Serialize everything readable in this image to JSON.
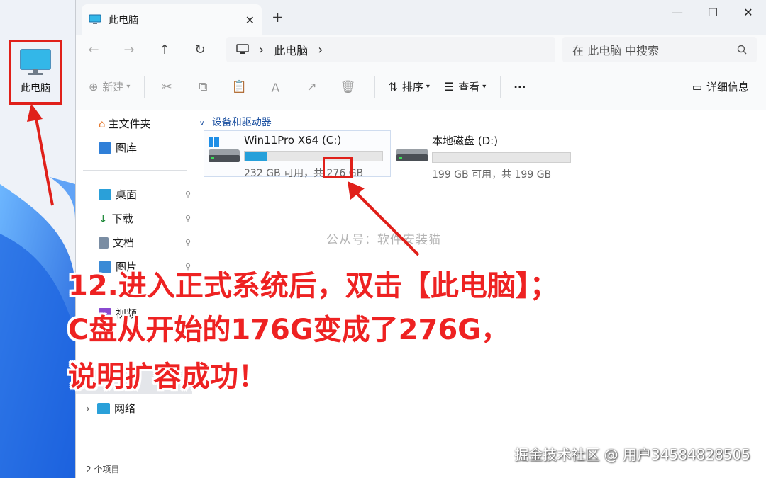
{
  "desktop": {
    "icon_label": "此电脑"
  },
  "window": {
    "tab_title": "此电脑",
    "tab_close": "✕",
    "new_tab": "+",
    "controls": {
      "minimize": "—",
      "maximize": "☐",
      "close": "✕"
    }
  },
  "nav": {
    "back": "←",
    "forward": "→",
    "up": "↑",
    "refresh": "↻",
    "breadcrumb": "此电脑",
    "chevron": "›",
    "search_placeholder": "在 此电脑 中搜索"
  },
  "toolbar": {
    "new_label": "新建",
    "sort_label": "排序",
    "view_label": "查看",
    "more_label": "···",
    "details_label": "详细信息"
  },
  "sidebar": {
    "items": [
      {
        "label": "主文件夹",
        "icon": "home-icon",
        "pinned": false
      },
      {
        "label": "图库",
        "icon": "gallery-icon",
        "pinned": false
      },
      {
        "label": "桌面",
        "icon": "desktop-folder-icon",
        "pinned": true
      },
      {
        "label": "下载",
        "icon": "download-icon",
        "pinned": true
      },
      {
        "label": "文档",
        "icon": "document-icon",
        "pinned": true
      },
      {
        "label": "图片",
        "icon": "picture-icon",
        "pinned": true
      },
      {
        "label": "视频",
        "icon": "video-icon",
        "pinned": false
      },
      {
        "label": "网络",
        "icon": "network-icon",
        "pinned": false
      }
    ],
    "pin_glyph": "📌",
    "expand_glyph": "›"
  },
  "content": {
    "group_header": "设备和驱动器",
    "drives": [
      {
        "name": "Win11Pro X64 (C:)",
        "space_text": "232 GB 可用，共 276 GB",
        "used_fraction": 0.16,
        "icon": "windows-drive-icon"
      },
      {
        "name": "本地磁盘 (D:)",
        "space_text": "199 GB 可用，共 199 GB",
        "used_fraction": 0.0,
        "icon": "drive-icon"
      }
    ]
  },
  "status": {
    "item_count": "2 个项目"
  },
  "overlay": {
    "watermark": "公从号：软件安装猫",
    "annotation_lines": [
      "12.进入正式系统后，双击【此电脑】；",
      "C盘从开始的176G变成了276G，",
      "说明扩容成功！"
    ],
    "credit": "掘金技术社区 @ 用户34584828505",
    "highlight_color": "#e0201a",
    "annotation_color": "#ee2222"
  }
}
